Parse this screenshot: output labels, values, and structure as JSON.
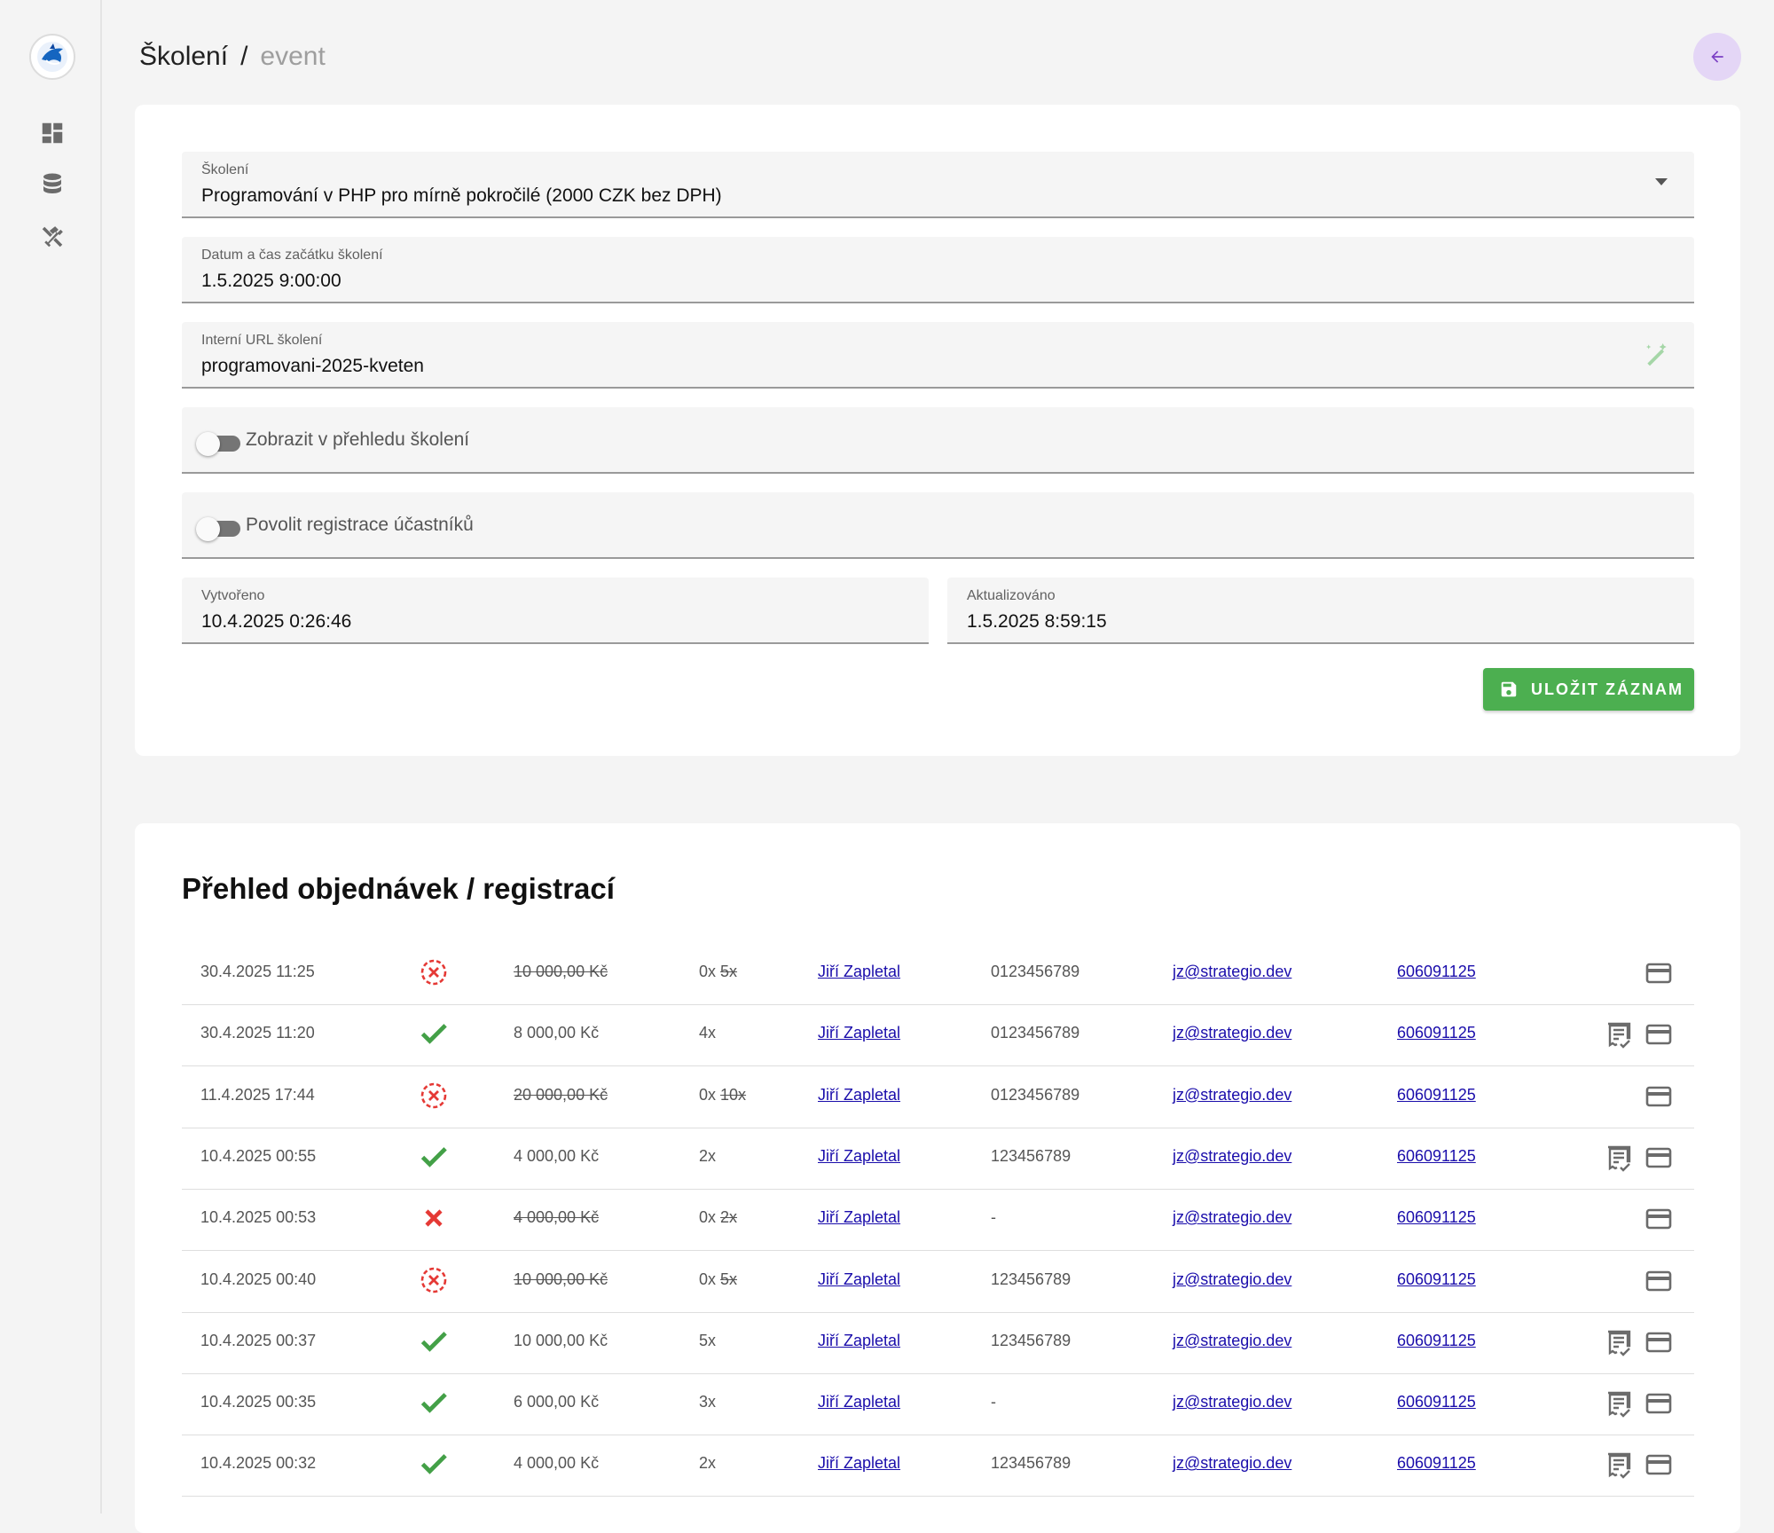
{
  "breadcrumb": {
    "root": "Školení",
    "separator": "/",
    "current": "event"
  },
  "form": {
    "course": {
      "label": "Školení",
      "value": "Programování v PHP pro mírně pokročilé (2000 CZK bez DPH)"
    },
    "start": {
      "label": "Datum a čas začátku školení",
      "value": "1.5.2025 9:00:00"
    },
    "url": {
      "label": "Interní URL školení",
      "value": "programovani-2025-kveten"
    },
    "toggle_overview": {
      "label": "Zobrazit v přehledu školení",
      "on": false
    },
    "toggle_registration": {
      "label": "Povolit registrace účastníků",
      "on": false
    },
    "created": {
      "label": "Vytvořeno",
      "value": "10.4.2025 0:26:46"
    },
    "updated": {
      "label": "Aktualizováno",
      "value": "1.5.2025 8:59:15"
    },
    "save_label": "ULOŽIT ZÁZNAM"
  },
  "orders": {
    "title": "Přehled objednávek / registrací",
    "rows": [
      {
        "date": "30.4.2025 11:25",
        "status": "cancelled",
        "price": "10 000,00 Kč",
        "price_struck": true,
        "qty_prefix": "0x",
        "qty_struck": "5x",
        "name": "Jiří Zapletal",
        "ico": "0123456789",
        "email": "jz@strategio.dev",
        "phone": "606091125",
        "invoice": false
      },
      {
        "date": "30.4.2025 11:20",
        "status": "paid",
        "price": "8 000,00 Kč",
        "price_struck": false,
        "qty_prefix": "4x",
        "qty_struck": "",
        "name": "Jiří Zapletal",
        "ico": "0123456789",
        "email": "jz@strategio.dev",
        "phone": "606091125",
        "invoice": true
      },
      {
        "date": "11.4.2025 17:44",
        "status": "cancelled",
        "price": "20 000,00 Kč",
        "price_struck": true,
        "qty_prefix": "0x",
        "qty_struck": "10x",
        "name": "Jiří Zapletal",
        "ico": "0123456789",
        "email": "jz@strategio.dev",
        "phone": "606091125",
        "invoice": false
      },
      {
        "date": "10.4.2025 00:55",
        "status": "paid",
        "price": "4 000,00 Kč",
        "price_struck": false,
        "qty_prefix": "2x",
        "qty_struck": "",
        "name": "Jiří Zapletal",
        "ico": "123456789",
        "email": "jz@strategio.dev",
        "phone": "606091125",
        "invoice": true
      },
      {
        "date": "10.4.2025 00:53",
        "status": "failed",
        "price": "4 000,00 Kč",
        "price_struck": true,
        "qty_prefix": "0x",
        "qty_struck": "2x",
        "name": "Jiří Zapletal",
        "ico": "-",
        "email": "jz@strategio.dev",
        "phone": "606091125",
        "invoice": false
      },
      {
        "date": "10.4.2025 00:40",
        "status": "cancelled",
        "price": "10 000,00 Kč",
        "price_struck": true,
        "qty_prefix": "0x",
        "qty_struck": "5x",
        "name": "Jiří Zapletal",
        "ico": "123456789",
        "email": "jz@strategio.dev",
        "phone": "606091125",
        "invoice": false
      },
      {
        "date": "10.4.2025 00:37",
        "status": "paid",
        "price": "10 000,00 Kč",
        "price_struck": false,
        "qty_prefix": "5x",
        "qty_struck": "",
        "name": "Jiří Zapletal",
        "ico": "123456789",
        "email": "jz@strategio.dev",
        "phone": "606091125",
        "invoice": true
      },
      {
        "date": "10.4.2025 00:35",
        "status": "paid",
        "price": "6 000,00 Kč",
        "price_struck": false,
        "qty_prefix": "3x",
        "qty_struck": "",
        "name": "Jiří Zapletal",
        "ico": "-",
        "email": "jz@strategio.dev",
        "phone": "606091125",
        "invoice": true
      },
      {
        "date": "10.4.2025 00:32",
        "status": "paid",
        "price": "4 000,00 Kč",
        "price_struck": false,
        "qty_prefix": "2x",
        "qty_struck": "",
        "name": "Jiří Zapletal",
        "ico": "123456789",
        "email": "jz@strategio.dev",
        "phone": "606091125",
        "invoice": true
      }
    ]
  },
  "icons": {
    "nav": [
      "dashboard-icon",
      "database-icon",
      "tools-icon"
    ],
    "back": "arrow-left-icon",
    "save": "floppy-disk-icon",
    "url_generate": "magic-wand-icon",
    "status_paid": "check-icon",
    "status_cancelled": "cancel-circle-icon",
    "status_failed": "close-icon",
    "invoice": "receipt-icon",
    "payment": "credit-card-icon"
  },
  "colors": {
    "accent": "#4caf50",
    "back_button_bg": "#e4d6f6",
    "back_arrow": "#7b3fc4",
    "paid": "#43a047",
    "cancelled": "#e53935",
    "link": "#1a0dab"
  }
}
